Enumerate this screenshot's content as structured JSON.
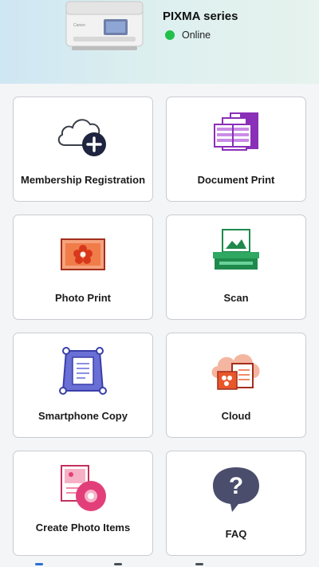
{
  "header": {
    "printer_name": "PIXMA series",
    "status": "Online",
    "status_color": "#20c04a"
  },
  "tiles": [
    {
      "label": "Membership Registration",
      "icon": "cloud-plus-icon"
    },
    {
      "label": "Document Print",
      "icon": "document-print-icon"
    },
    {
      "label": "Photo Print",
      "icon": "photo-print-icon"
    },
    {
      "label": "Scan",
      "icon": "scan-icon"
    },
    {
      "label": "Smartphone Copy",
      "icon": "smartphone-copy-icon"
    },
    {
      "label": "Cloud",
      "icon": "cloud-icon"
    },
    {
      "label": "Create Photo Items",
      "icon": "create-photo-items-icon"
    },
    {
      "label": "FAQ",
      "icon": "faq-icon"
    }
  ],
  "colors": {
    "accent_purple": "#8a2fb8",
    "accent_orange": "#e8572a",
    "accent_green": "#1f8a4c",
    "accent_indigo": "#6a6fd6",
    "accent_pink": "#e23f7a",
    "faq_dark": "#4a4d6c"
  }
}
